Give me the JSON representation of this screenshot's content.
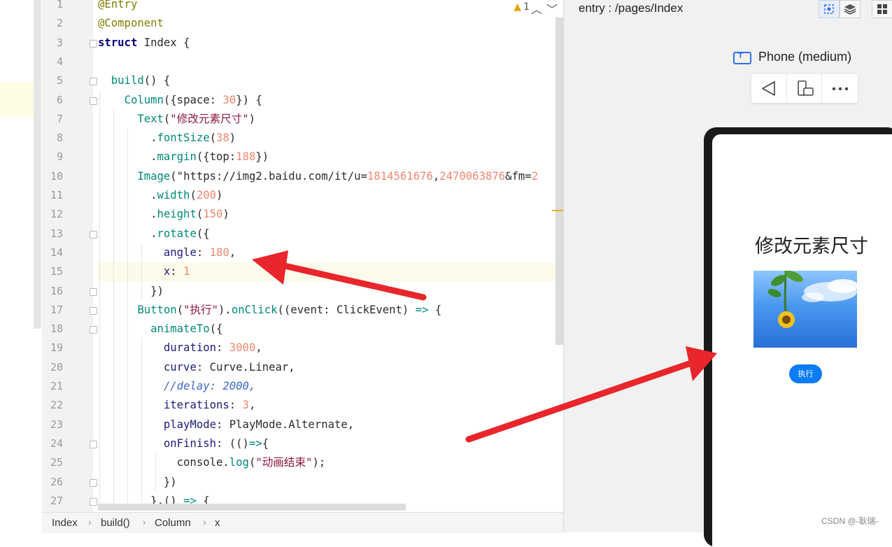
{
  "editor": {
    "lines": [
      {
        "n": "1",
        "code": "@Entry"
      },
      {
        "n": "2",
        "code": "@Component"
      },
      {
        "n": "3",
        "code": "struct Index {"
      },
      {
        "n": "4",
        "code": ""
      },
      {
        "n": "5",
        "code": "  build() {"
      },
      {
        "n": "6",
        "code": "    Column({space: 30}) {"
      },
      {
        "n": "7",
        "code": "      Text(\"修改元素尺寸\")"
      },
      {
        "n": "8",
        "code": "        .fontSize(38)"
      },
      {
        "n": "9",
        "code": "        .margin({top:188})"
      },
      {
        "n": "10",
        "code": "      Image(\"https://img2.baidu.com/it/u=1814561676,2470063876&fm=2"
      },
      {
        "n": "11",
        "code": "        .width(200)"
      },
      {
        "n": "12",
        "code": "        .height(150)"
      },
      {
        "n": "13",
        "code": "        .rotate({"
      },
      {
        "n": "14",
        "code": "          angle: 180,"
      },
      {
        "n": "15",
        "code": "          x: 1"
      },
      {
        "n": "16",
        "code": "        })"
      },
      {
        "n": "17",
        "code": "      Button(\"执行\").onClick((event: ClickEvent) => {"
      },
      {
        "n": "18",
        "code": "        animateTo({"
      },
      {
        "n": "19",
        "code": "          duration: 3000,"
      },
      {
        "n": "20",
        "code": "          curve: Curve.Linear,"
      },
      {
        "n": "21",
        "code": "          //delay: 2000,"
      },
      {
        "n": "22",
        "code": "          iterations: 3,"
      },
      {
        "n": "23",
        "code": "          playMode: PlayMode.Alternate,"
      },
      {
        "n": "24",
        "code": "          onFinish: (()=>{"
      },
      {
        "n": "25",
        "code": "            console.log(\"动画结束\");"
      },
      {
        "n": "26",
        "code": "          })"
      },
      {
        "n": "27",
        "code": "        },() => {"
      }
    ],
    "active_line": 15,
    "warning_count": "1"
  },
  "breadcrumb": [
    "Index",
    "build()",
    "Column",
    "x"
  ],
  "preview": {
    "title": "entry : /pages/Index",
    "device": "Phone (medium)",
    "app": {
      "title": "修改元素尺寸",
      "button": "执行"
    }
  },
  "watermark": "CSDN @-耿瑞-",
  "colors": {
    "accent": "#0a7cf5",
    "arrow": "#e8262b",
    "warning": "#e3a400"
  }
}
